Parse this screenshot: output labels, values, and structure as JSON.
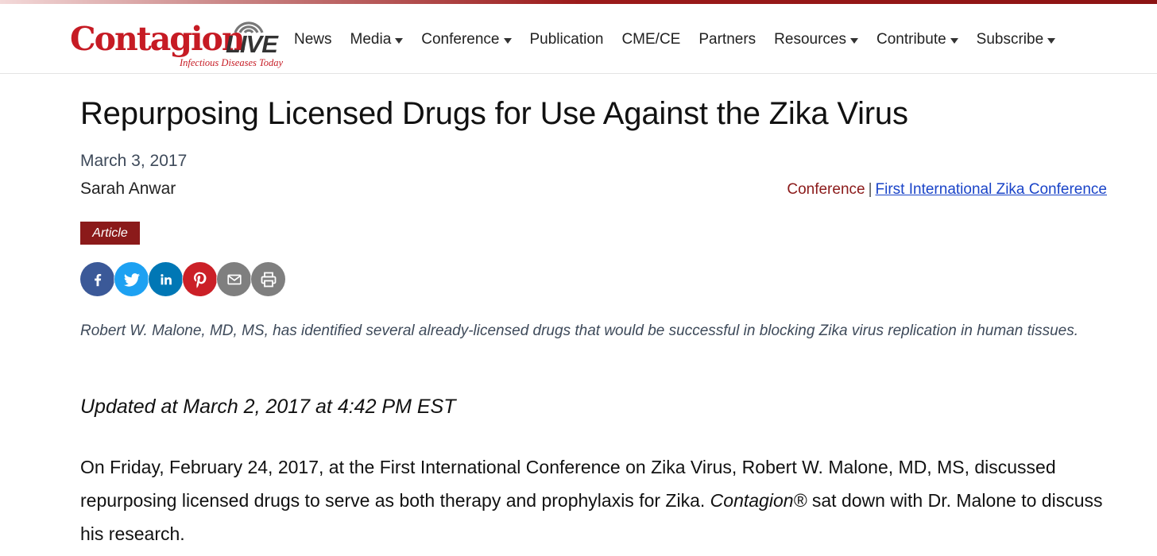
{
  "colors": {
    "brand_red": "#c61b24",
    "dark_red": "#8b1a1a",
    "link_blue": "#1a44c8"
  },
  "logo": {
    "brand": "Contagion",
    "live": "LIVE",
    "tagline": "Infectious Diseases Today"
  },
  "nav": [
    {
      "label": "News",
      "dropdown": false
    },
    {
      "label": "Media",
      "dropdown": true
    },
    {
      "label": "Conference",
      "dropdown": true
    },
    {
      "label": "Publication",
      "dropdown": false
    },
    {
      "label": "CME/CE",
      "dropdown": false
    },
    {
      "label": "Partners",
      "dropdown": false
    },
    {
      "label": "Resources",
      "dropdown": true
    },
    {
      "label": "Contribute",
      "dropdown": true
    },
    {
      "label": "Subscribe",
      "dropdown": true
    }
  ],
  "article": {
    "title": "Repurposing Licensed Drugs for Use Against the Zika Virus",
    "date": "March 3, 2017",
    "author": "Sarah Anwar",
    "breadcrumb": {
      "category": "Conference",
      "separator": "|",
      "link": "First International Zika Conference"
    },
    "badge": "Article",
    "share_icons": [
      {
        "name": "facebook-icon",
        "color": "#3b5998"
      },
      {
        "name": "twitter-icon",
        "color": "#1da1f2"
      },
      {
        "name": "linkedin-icon",
        "color": "#0077b5"
      },
      {
        "name": "pinterest-icon",
        "color": "#cb2027"
      },
      {
        "name": "email-icon",
        "color": "#7f7f7f"
      },
      {
        "name": "print-icon",
        "color": "#7f7f7f"
      }
    ],
    "summary": "Robert W. Malone, MD, MS, has identified several already-licensed drugs that would be successful in blocking Zika virus replication in human tissues.",
    "updated": "Updated at March 2, 2017 at 4:42 PM EST",
    "body": {
      "part1": "On Friday, February 24, 2017, at the First International Conference on Zika Virus, Robert W. Malone, MD, MS, discussed repurposing licensed drugs to serve as both therapy and prophylaxis for Zika. ",
      "emphasis": "Contagion®",
      "part2": " sat down with Dr. Malone to discuss his research."
    }
  }
}
